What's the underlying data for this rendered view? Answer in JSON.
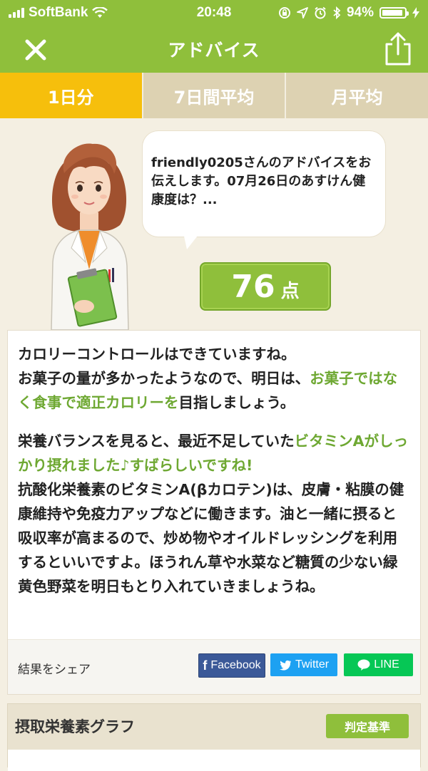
{
  "status_bar": {
    "carrier": "SoftBank",
    "time": "20:48",
    "battery_percent": "94%",
    "battery_level": 0.94,
    "icons": [
      "signal-icon",
      "wifi-icon",
      "rotation-lock-icon",
      "location-icon",
      "alarm-icon",
      "bluetooth-icon",
      "battery-icon",
      "charging-icon"
    ]
  },
  "nav": {
    "title": "アドバイス",
    "close_icon": "close-icon",
    "share_icon": "share-icon"
  },
  "tabs": [
    {
      "label": "1日分",
      "active": true
    },
    {
      "label": "7日間平均",
      "active": false
    },
    {
      "label": "月平均",
      "active": false
    }
  ],
  "advisor": {
    "bubble_text": "friendly0205さんのアドバイスをお伝えします。07月26日のあすけん健康度は？...",
    "score": "76",
    "score_unit": "点"
  },
  "advice": {
    "p1_line1": "カロリーコントロールはできていますね。",
    "p1_pre": "お菓子の量が多かったようなので、明日は、",
    "p1_highlight": "お菓子ではなく食事で適正カロリーを",
    "p1_post": "目指しましょう。",
    "p2_pre": "栄養バランスを見ると、最近不足していた",
    "p2_highlight": "ビタミンAがしっかり摂れました♪すばらしいですね!",
    "p3": "抗酸化栄養素のビタミンA(βカロテン)は、皮膚・粘膜の健康維持や免疫力アップなどに働きます。油と一緒に摂ると吸収率が高まるので、炒め物やオイルドレッシングを利用するといいですよ。ほうれん草や水菜など糖質の少ない緑黄色野菜を明日もとり入れていきましょうね。"
  },
  "share": {
    "label": "結果をシェア",
    "facebook": "Facebook",
    "twitter": "Twitter",
    "line": "LINE"
  },
  "graph": {
    "title": "摂取栄養素グラフ",
    "criteria_button": "判定基準"
  },
  "colors": {
    "accent_green": "#8fbf3b",
    "highlight_green": "#6ea832",
    "active_tab": "#f6bf0c",
    "inactive_tab": "#ddd2b2",
    "facebook": "#3b5998",
    "twitter": "#1da1f2",
    "line": "#06c755"
  }
}
